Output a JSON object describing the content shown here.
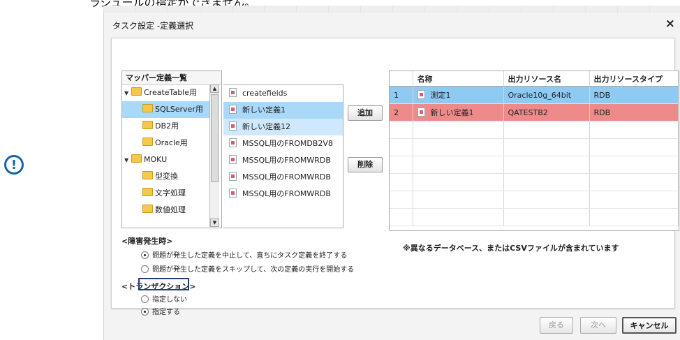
{
  "page": {
    "caption": "ラジュールの指定ができません。"
  },
  "dialog": {
    "title": "タスク設定 -定義選択",
    "close": "×"
  },
  "tree": {
    "header": "マッパー定義一覧",
    "items": [
      {
        "label": "CreateTable用"
      },
      {
        "label": "SQLServer用"
      },
      {
        "label": "DB2用"
      },
      {
        "label": "Oracle用"
      },
      {
        "label": "MOKU"
      },
      {
        "label": "型変換"
      },
      {
        "label": "文字処理"
      },
      {
        "label": "数値処理"
      }
    ]
  },
  "files": [
    {
      "label": "createfields"
    },
    {
      "label": "新しい定義1"
    },
    {
      "label": "新しい定義12"
    },
    {
      "label": "MSSQL用のFROMDB2V8"
    },
    {
      "label": "MSSQL用のFROMWRDB"
    },
    {
      "label": "MSSQL用のFROMWRDB"
    },
    {
      "label": "MSSQL用のFROMWRDB"
    }
  ],
  "buttons": {
    "add": "追加",
    "remove": "削除",
    "back": "戻る",
    "next": "次へ",
    "cancel": "キャンセル"
  },
  "grid": {
    "headers": [
      "",
      "名称",
      "出力リソース名",
      "出力リソースタイプ"
    ],
    "rows": [
      {
        "no": "1",
        "name": "測定1",
        "resource": "Oracle10g_64bit",
        "type": "RDB"
      },
      {
        "no": "2",
        "name": "新しい定義1",
        "resource": "QATESTB2",
        "type": "RDB"
      }
    ]
  },
  "note": "※異なるデータベース、またはCSVファイルが含まれています",
  "error": {
    "title": "<障害発生時>",
    "options": [
      {
        "label": "問題が発生した定義を中止して、直ちにタスク定義を終了する",
        "checked": true
      },
      {
        "label": "問題が発生した定義をスキップして、次の定義の実行を開始する",
        "checked": false
      }
    ]
  },
  "transaction": {
    "title": "<トランザクション>",
    "options": [
      {
        "label": "指定しない",
        "checked": false
      },
      {
        "label": "指定する",
        "checked": true
      }
    ]
  },
  "colors": {
    "selected": "#a9d8f8",
    "row_blue": "#8fcaf3",
    "row_red": "#ee8a8a",
    "info": "#1565a8"
  }
}
